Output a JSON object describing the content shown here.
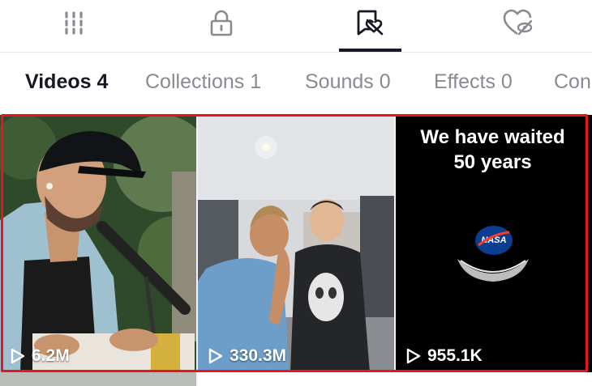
{
  "top_tabs": [
    {
      "name": "grid-icon"
    },
    {
      "name": "lock-icon"
    },
    {
      "name": "liked-icon",
      "active": true
    },
    {
      "name": "hidden-heart-icon"
    }
  ],
  "subtabs": [
    {
      "label": "Videos 4",
      "active": true
    },
    {
      "label": "Collections 1"
    },
    {
      "label": "Sounds 0"
    },
    {
      "label": "Effects 0"
    },
    {
      "label": "Con"
    }
  ],
  "videos": [
    {
      "views": "6.2M"
    },
    {
      "views": "330.3M"
    },
    {
      "views": "955.1K",
      "overlay_text": "We have waited\n50 years",
      "logo": "NASA"
    }
  ],
  "colors": {
    "active_text": "#161823",
    "inactive_text": "#8a8b91",
    "highlight": "#e8141e"
  }
}
